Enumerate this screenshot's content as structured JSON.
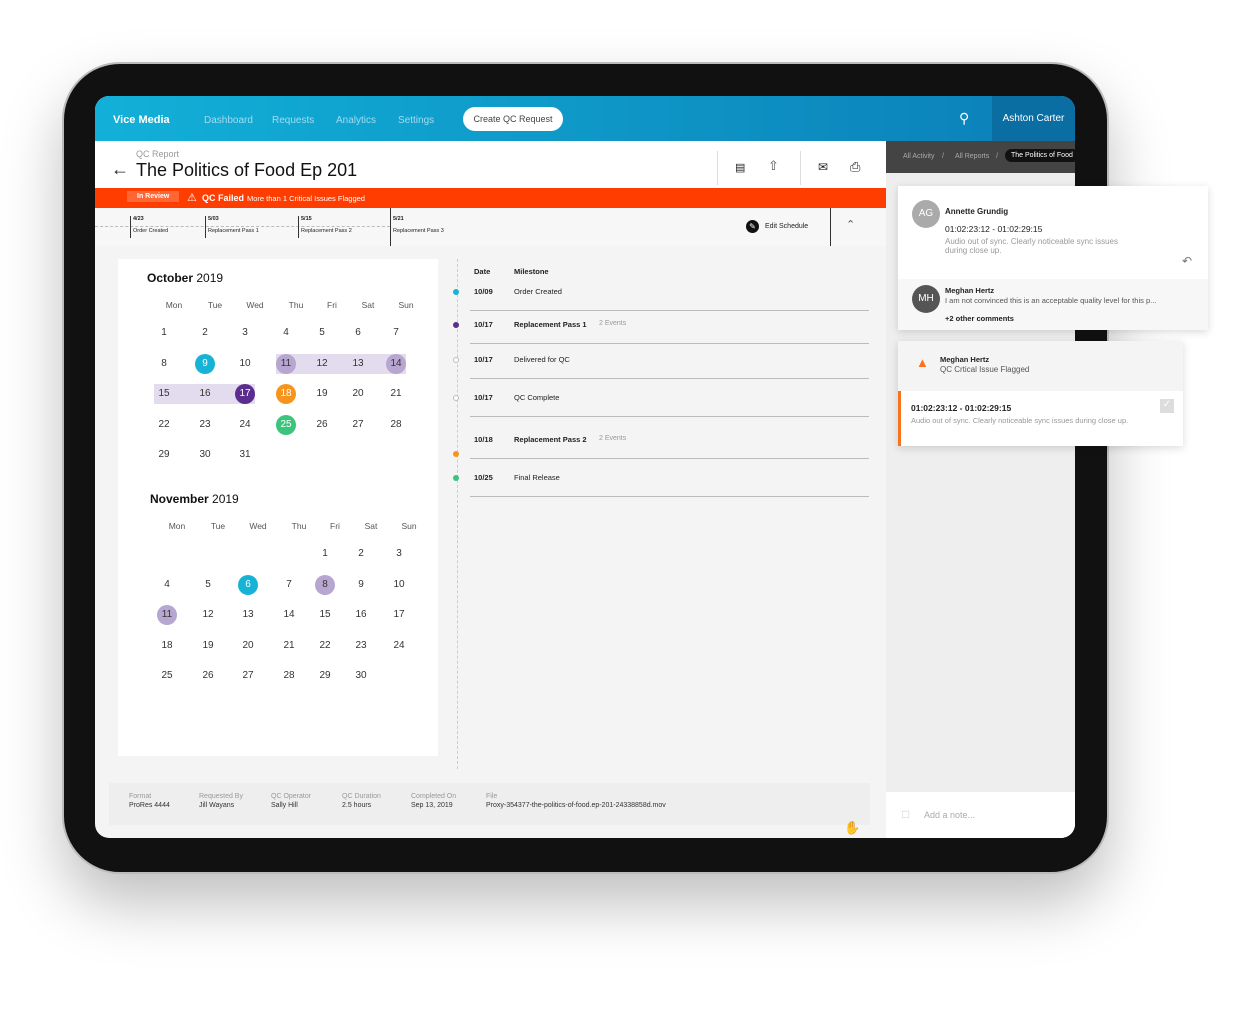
{
  "nav": {
    "brand": "Vice Media",
    "items": [
      "Dashboard",
      "Requests",
      "Analytics",
      "Settings"
    ],
    "create_button": "Create QC Request",
    "user": "Ashton Carter"
  },
  "header": {
    "subtitle": "QC Report",
    "title": "The Politics of Food Ep 201"
  },
  "banner": {
    "badge": "In Review",
    "status": "QC Failed",
    "message": "More than 1 Critical Issues Flagged",
    "color": "#ff3d00"
  },
  "schedule": {
    "milestones": [
      {
        "date": "4/23",
        "label": "Order Created"
      },
      {
        "date": "5/03",
        "label": "Replacement Pass 1"
      },
      {
        "date": "5/15",
        "label": "Replacement Pass 2"
      },
      {
        "date": "5/21",
        "label": "Replacement Pass 3"
      }
    ],
    "edit_label": "Edit Schedule"
  },
  "calendar": {
    "dows": [
      "Mon",
      "Tue",
      "Wed",
      "Thu",
      "Fri",
      "Sat",
      "Sun"
    ],
    "months": [
      {
        "name": "October",
        "year": "2019",
        "offset": 0,
        "days": 31,
        "marks": {
          "9": "#17b3d6",
          "11": "#b7a6cf",
          "14": "#b7a6cf",
          "17": "#5b2d8e",
          "18": "#f7941d",
          "25": "#3cc47c"
        },
        "ranges": [
          [
            11,
            14
          ],
          [
            15,
            17
          ]
        ]
      },
      {
        "name": "November",
        "year": "2019",
        "offset": 4,
        "days": 30,
        "marks": {
          "6": "#17b3d6",
          "8": "#b7a6cf",
          "11": "#b7a6cf"
        },
        "ranges": [
          [
            8,
            11
          ]
        ]
      }
    ]
  },
  "milestones": {
    "headers": {
      "date": "Date",
      "milestone": "Milestone"
    },
    "rows": [
      {
        "date": "10/09",
        "name": "Order Created",
        "events": "",
        "color": "#17b3d6",
        "bold": false
      },
      {
        "date": "10/17",
        "name": "Replacement Pass 1",
        "events": "2 Events",
        "color": "#5b2d8e",
        "bold": true
      },
      {
        "date": "10/17",
        "name": "Delivered for QC",
        "events": "",
        "color": "",
        "bold": false
      },
      {
        "date": "10/17",
        "name": "QC Complete",
        "events": "",
        "color": "",
        "bold": false
      },
      {
        "date": "10/18",
        "name": "Replacement Pass 2",
        "events": "2 Events",
        "color": "#f7941d",
        "bold": true
      },
      {
        "date": "10/25",
        "name": "Final Release",
        "events": "",
        "color": "#3cc47c",
        "bold": false
      }
    ]
  },
  "footer": [
    {
      "label": "Format",
      "value": "ProRes 4444"
    },
    {
      "label": "Requested By",
      "value": "Jill Wayans"
    },
    {
      "label": "QC Operator",
      "value": "Sally Hill"
    },
    {
      "label": "QC Duration",
      "value": "2.5 hours"
    },
    {
      "label": "Completed On",
      "value": "Sep 13, 2019"
    },
    {
      "label": "File",
      "value": "Proxy-354377-the-politics-of-food.ep-201-24338858d.mov"
    }
  ],
  "side": {
    "crumbs": [
      "All Activity",
      "All Reports",
      "The Politics of Food"
    ],
    "comment": {
      "initials": "AG",
      "author": "Annette Grundig",
      "timecode": "01:02:23:12 - 01:02:29:15",
      "text": "Audio out  of sync. Clearly noticeable sync issues during close up.",
      "reply_initials": "MH",
      "reply_author": "Meghan Hertz",
      "reply_text": "I am not convinced this is an acceptable quality level for this p...",
      "more": "+2 other comments"
    },
    "alert": {
      "author": "Meghan Hertz",
      "title": "QC Crtical Issue Flagged",
      "timecode": "01:02:23:12 - 01:02:29:15",
      "text": "Audio out  of sync. Clearly noticeable sync issues during close up."
    },
    "note_placeholder": "Add a note..."
  }
}
